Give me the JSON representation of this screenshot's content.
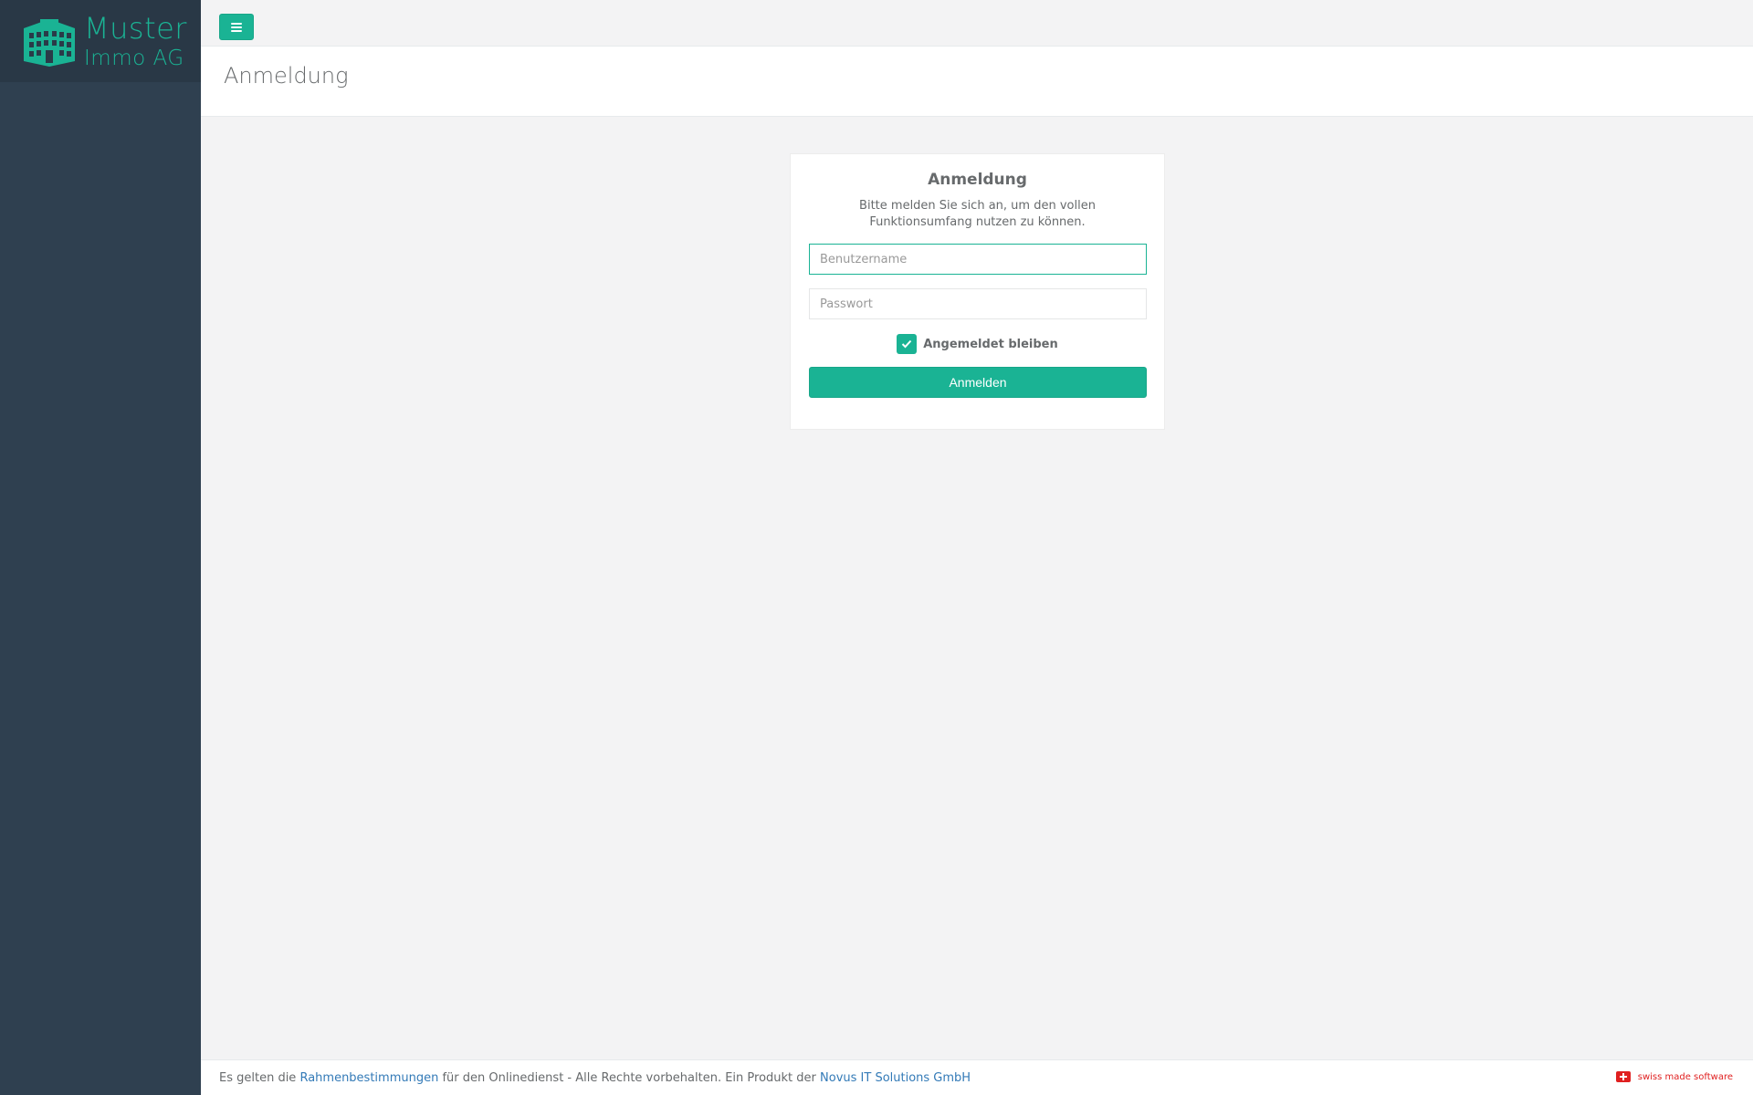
{
  "brand": {
    "name_line1": "Muster",
    "name_line2": "Immo AG",
    "accent_color": "#1ab394",
    "logo_icon": "building-icon"
  },
  "topbar": {
    "menu_icon": "hamburger-icon"
  },
  "page": {
    "title": "Anmeldung"
  },
  "login": {
    "title": "Anmeldung",
    "description": "Bitte melden Sie sich an, um den vollen Funktionsumfang nutzen zu können.",
    "username_placeholder": "Benutzername",
    "username_value": "",
    "password_placeholder": "Passwort",
    "password_value": "",
    "remember_label": "Angemeldet bleiben",
    "remember_checked": true,
    "submit_label": "Anmelden"
  },
  "footer": {
    "text_before": "Es gelten die ",
    "terms_link": "Rahmenbestimmungen",
    "text_middle": " für den Onlinedienst - Alle Rechte vorbehalten. Ein Produkt der ",
    "company_link": "Novus IT Solutions GmbH",
    "badge_text": "swiss made software",
    "badge_icon": "swiss-flag-icon"
  }
}
